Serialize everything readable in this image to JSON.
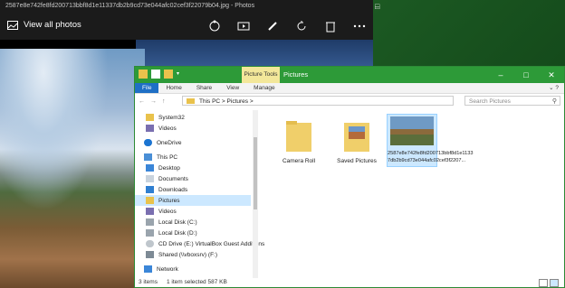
{
  "photos": {
    "title": "2587e8e742fe8fd200713bbf8d1e11337db2b9cd73e044afc02cef3f22079b04.jpg - Photos",
    "view_all": "View all photos",
    "toolbar": [
      "share-icon",
      "slideshow-icon",
      "edit-icon",
      "rotate-icon",
      "delete-icon",
      "more-icon"
    ]
  },
  "explorer": {
    "context_tab": "Picture Tools",
    "title": "Pictures",
    "ribbon_tabs": [
      "File",
      "Home",
      "Share",
      "View",
      "Manage"
    ],
    "address": [
      "This PC",
      "Pictures"
    ],
    "search_placeholder": "Search Pictures",
    "nav": [
      "System32",
      "Videos",
      "OneDrive",
      "This PC",
      "Desktop",
      "Documents",
      "Downloads",
      "Pictures",
      "Videos",
      "Local Disk (C:)",
      "Local Disk (D:)",
      "CD Drive (E:) VirtualBox Guest Additions",
      "Shared (\\\\vboxsrv) (F:)",
      "Network"
    ],
    "items": [
      {
        "name": "Camera Roll"
      },
      {
        "name": "Saved Pictures"
      },
      {
        "name": "2587e8e742fe8fd200713bbf8d1e1133 7db2b9cd73e044afc02cef3f2207..."
      }
    ],
    "status": {
      "count": "3 items",
      "selection": "1 item selected  587 KB"
    }
  },
  "colors": {
    "explorer_green": "#2d9a38",
    "file_tab": "#1f6fc5",
    "selection": "#cce8ff"
  }
}
